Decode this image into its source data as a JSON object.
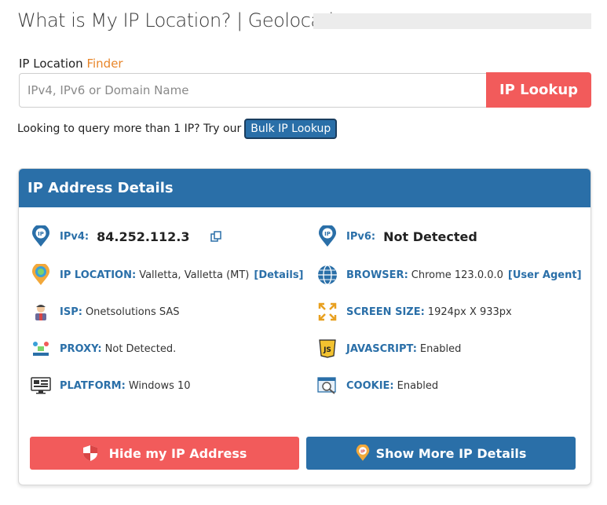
{
  "header": {
    "title": "What is My IP Location? | Geolocation"
  },
  "search": {
    "label_prefix": "IP Location",
    "label_accent": "Finder",
    "placeholder": "IPv4, IPv6 or Domain Name",
    "value": "",
    "button_label": "IP Lookup"
  },
  "bulk": {
    "text": "Looking to query more than 1 IP? Try our",
    "button_label": "Bulk IP Lookup"
  },
  "details": {
    "title": "IP Address Details",
    "ipv4": {
      "label": "IPv4:",
      "value": "84.252.112.3"
    },
    "ipv6": {
      "label": "IPv6:",
      "value": "Not Detected"
    },
    "location": {
      "label": "IP LOCATION:",
      "value": "Valletta, Valletta (MT)",
      "link": "[Details]"
    },
    "browser": {
      "label": "BROWSER:",
      "value": "Chrome 123.0.0.0",
      "link": "[User Agent]"
    },
    "isp": {
      "label": "ISP:",
      "value": "Onetsolutions SAS"
    },
    "screen": {
      "label": "SCREEN SIZE:",
      "value": "1924px X 933px"
    },
    "proxy": {
      "label": "PROXY:",
      "value": "Not Detected."
    },
    "javascript": {
      "label": "JAVASCRIPT:",
      "value": "Enabled"
    },
    "platform": {
      "label": "PLATFORM:",
      "value": "Windows 10"
    },
    "cookie": {
      "label": "COOKIE:",
      "value": "Enabled"
    }
  },
  "actions": {
    "hide_label": "Hide my IP Address",
    "more_label": "Show More IP Details"
  },
  "colors": {
    "primary": "#2a6fa8",
    "danger": "#f25b5b",
    "accent": "#e8862a"
  }
}
